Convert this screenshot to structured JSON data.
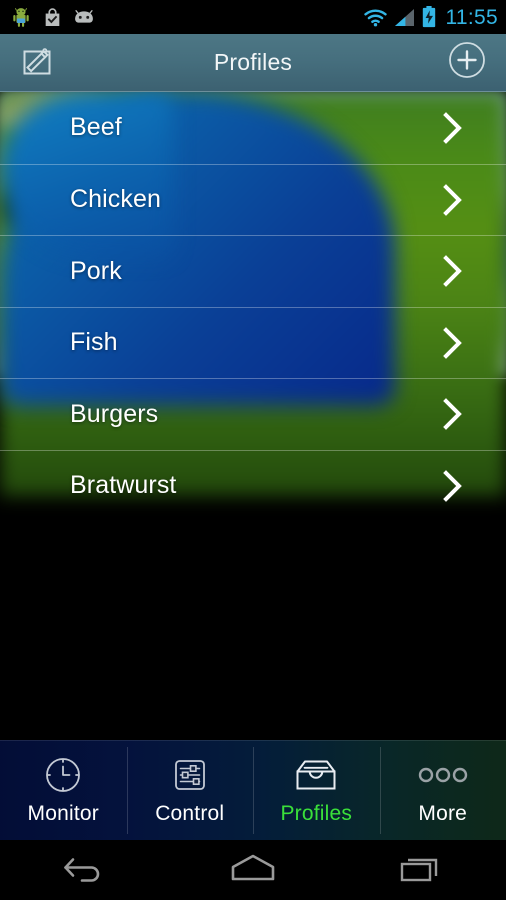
{
  "status_bar": {
    "time": "11:55",
    "time_color": "#33b5e5",
    "left_icons": [
      {
        "name": "android-robot-icon",
        "label": "Android"
      },
      {
        "name": "play-store-bag-check-icon",
        "label": "Play Store"
      },
      {
        "name": "android-head-icon",
        "label": "Android Head"
      }
    ],
    "right_icons": [
      {
        "name": "wifi-icon",
        "label": "Wi-Fi"
      },
      {
        "name": "cellular-signal-icon",
        "label": "Signal"
      },
      {
        "name": "battery-charging-icon",
        "label": "Battery Charging"
      }
    ]
  },
  "action_bar": {
    "title": "Profiles",
    "edit_icon": "edit-pencil-square-icon",
    "add_icon": "add-circle-plus-icon",
    "background_start": "#4d7785",
    "background_end": "#3c6171"
  },
  "list": {
    "chevron_icon": "chevron-right-icon",
    "items": [
      {
        "label": "Beef"
      },
      {
        "label": "Chicken"
      },
      {
        "label": "Pork"
      },
      {
        "label": "Fish"
      },
      {
        "label": "Burgers"
      },
      {
        "label": "Bratwurst"
      }
    ]
  },
  "tab_bar": {
    "active_color": "#3ae03a",
    "inactive_color": "#ffffff",
    "tabs": [
      {
        "label": "Monitor",
        "icon": "clock-icon",
        "active": false
      },
      {
        "label": "Control",
        "icon": "sliders-icon",
        "active": false
      },
      {
        "label": "Profiles",
        "icon": "inbox-tray-icon",
        "active": true
      },
      {
        "label": "More",
        "icon": "three-dots-icon",
        "active": false
      }
    ]
  },
  "nav_bar": {
    "buttons": [
      {
        "name": "back-icon",
        "label": "Back"
      },
      {
        "name": "home-icon",
        "label": "Home"
      },
      {
        "name": "recents-icon",
        "label": "Recent Apps"
      }
    ]
  }
}
